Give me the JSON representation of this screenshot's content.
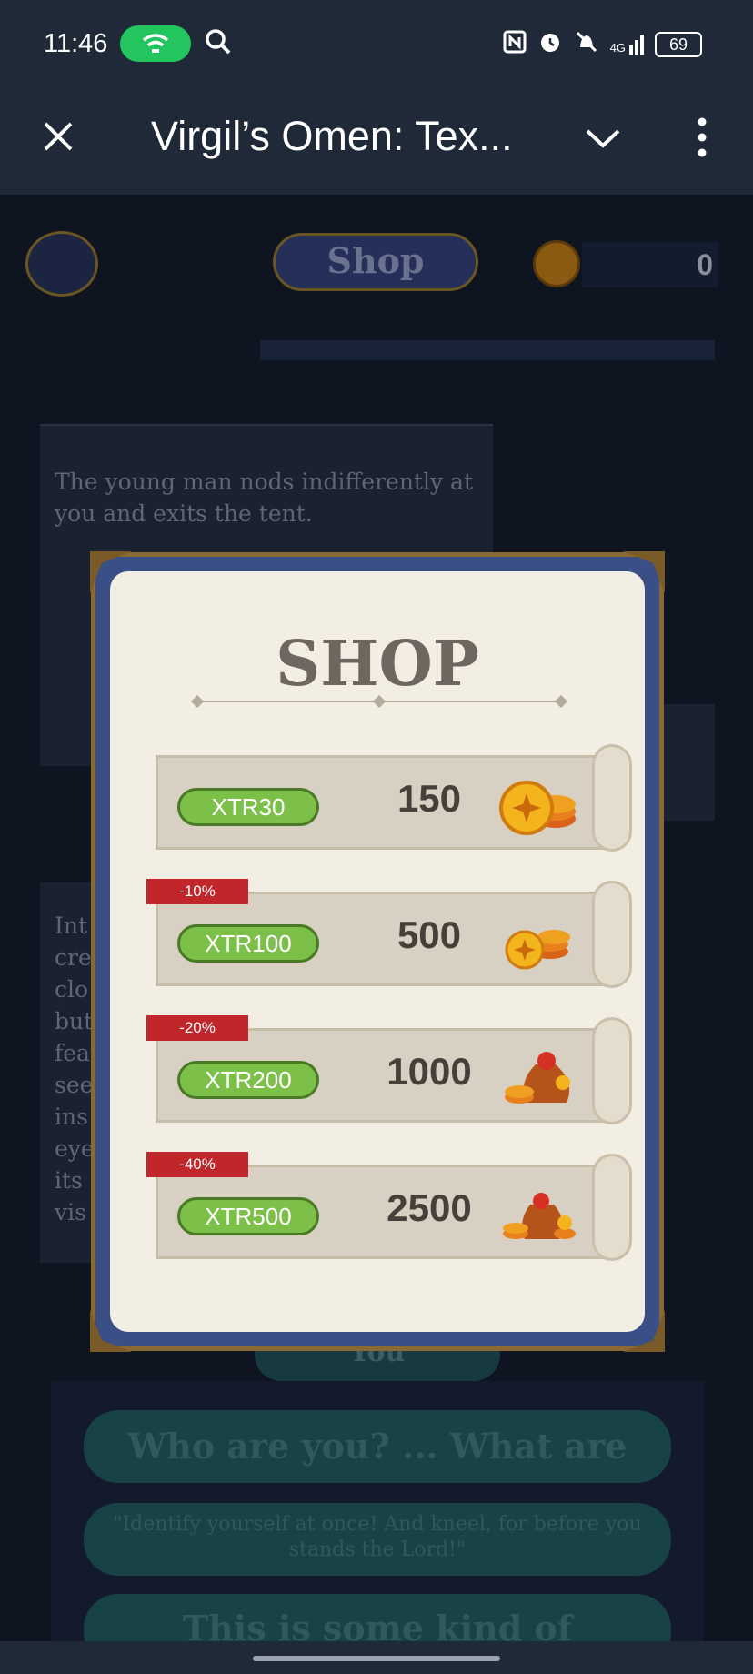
{
  "status_bar": {
    "time": "11:46",
    "network": "4G",
    "battery": "69",
    "icons": [
      "hotspot-icon",
      "search-icon",
      "nfc-icon",
      "alarm-icon",
      "mute-icon",
      "signal-icon",
      "battery-icon"
    ]
  },
  "top_bar": {
    "title": "Virgil’s Omen: Tex...",
    "icons": [
      "close-icon",
      "chevron-down-icon",
      "more-vert-icon"
    ]
  },
  "game": {
    "shop_tab": "Shop",
    "coin_count": "0",
    "story_1": "The young man nods indifferently at you and exits the tent.",
    "story_2_lines": [
      "Int",
      "cre",
      "clo",
      "but",
      "fea",
      "see",
      "ins",
      "eye",
      "its",
      "vis"
    ],
    "you_tab": "You",
    "choices": [
      "Who are you? ... What are you?",
      "\"Identify yourself at once! And kneel, for before you stands the Lord!\"",
      "This is some kind of mistake..."
    ]
  },
  "shop_modal": {
    "title": "SHOP",
    "items": [
      {
        "price": "XTR30",
        "amount": "150",
        "badge": "",
        "icon": "coin-pile-icon"
      },
      {
        "price": "XTR100",
        "amount": "500",
        "badge": "-10%",
        "icon": "coin-stack-icon"
      },
      {
        "price": "XTR200",
        "amount": "1000",
        "badge": "-20%",
        "icon": "coin-bag-icon"
      },
      {
        "price": "XTR500",
        "amount": "2500",
        "badge": "-40%",
        "icon": "coin-sacks-icon"
      }
    ]
  },
  "colors": {
    "system_bar": "#1f2937",
    "price_pill": "#7cc04a",
    "discount_badge": "#c0262a",
    "modal_frame": "#3a4f86"
  }
}
